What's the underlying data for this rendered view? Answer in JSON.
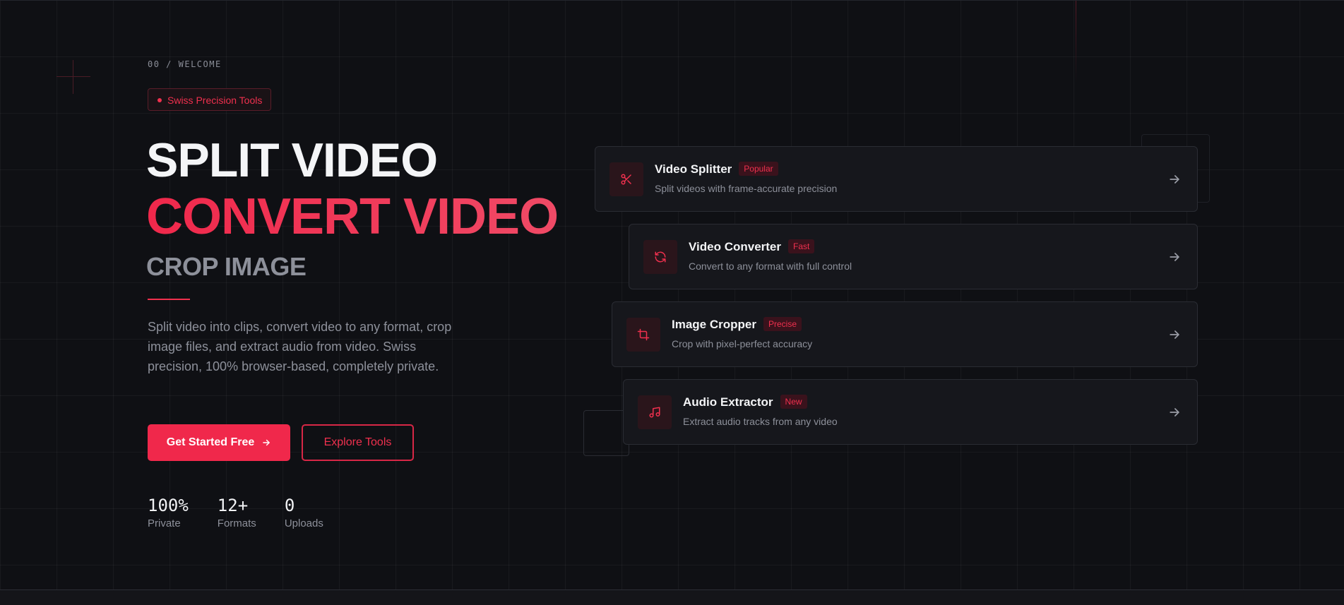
{
  "hero": {
    "eyebrow": "00 / WELCOME",
    "pill_label": "Swiss Precision Tools",
    "headline_1": "SPLIT VIDEO",
    "headline_2": "CONVERT VIDEO",
    "headline_3": "CROP IMAGE",
    "lead": "Split video into clips, convert video to any format, crop image files, and extract audio from video. Swiss precision, 100% browser-based, completely private.",
    "primary_button": "Get Started Free",
    "primary_button_icon": "arrow-right-icon",
    "secondary_button": "Explore Tools"
  },
  "stats": [
    {
      "value": "100%",
      "label": "Private"
    },
    {
      "value": "12+",
      "label": "Formats"
    },
    {
      "value": "0",
      "label": "Uploads"
    }
  ],
  "tools": [
    {
      "title": "Video Splitter",
      "badge": "Popular",
      "description": "Split videos with frame-accurate precision",
      "icon": "scissors-icon"
    },
    {
      "title": "Video Converter",
      "badge": "Fast",
      "description": "Convert to any format with full control",
      "icon": "refresh-icon"
    },
    {
      "title": "Image Cropper",
      "badge": "Precise",
      "description": "Crop with pixel-perfect accuracy",
      "icon": "crop-icon"
    },
    {
      "title": "Audio Extractor",
      "badge": "New",
      "description": "Extract audio tracks from any video",
      "icon": "music-note-icon"
    }
  ],
  "colors": {
    "background": "#0f1014",
    "accent": "#f0304e",
    "card": "#16171c",
    "muted_text": "#8d909a"
  }
}
